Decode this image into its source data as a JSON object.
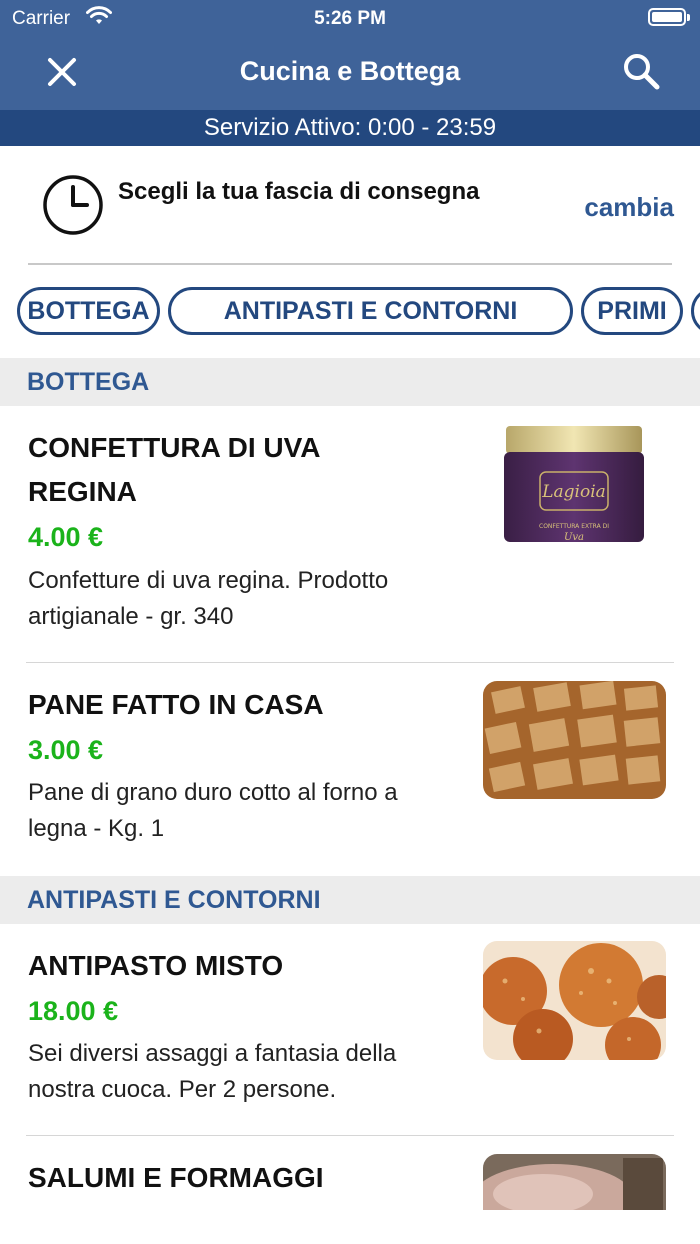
{
  "status_bar": {
    "carrier": "Carrier",
    "time": "5:26 PM"
  },
  "nav": {
    "title": "Cucina e Bottega"
  },
  "service_bar": {
    "text": "Servizio Attivo: 0:00 - 23:59"
  },
  "delivery": {
    "label": "Scegli la tua fascia di consegna",
    "change": "cambia"
  },
  "tabs": [
    {
      "label": "BOTTEGA"
    },
    {
      "label": "ANTIPASTI E CONTORNI"
    },
    {
      "label": "PRIMI"
    },
    {
      "label": ""
    }
  ],
  "sections": [
    {
      "title": "BOTTEGA"
    },
    {
      "title": "ANTIPASTI E CONTORNI"
    }
  ],
  "products": [
    {
      "name": "CONFETTURA DI UVA REGINA",
      "price": "4.00 €",
      "description": "Confetture di uva regina. Prodotto artigianale - gr. 340",
      "image_label": "Lagioia",
      "image_sublabel": "CONFETTURA EXTRA DI",
      "image_script": "Uva"
    },
    {
      "name": "PANE FATTO IN CASA",
      "price": "3.00 €",
      "description": "Pane di grano duro cotto al forno a legna - Kg. 1"
    },
    {
      "name": "ANTIPASTO MISTO",
      "price": "18.00 €",
      "description": "Sei diversi assaggi a fantasia della nostra cuoca. Per 2 persone."
    },
    {
      "name": "SALUMI E FORMAGGI",
      "price": "",
      "description": ""
    }
  ],
  "colors": {
    "header": "#3f6399",
    "service_bar": "#23487f",
    "accent": "#2f5892",
    "price": "#1bb31b"
  }
}
